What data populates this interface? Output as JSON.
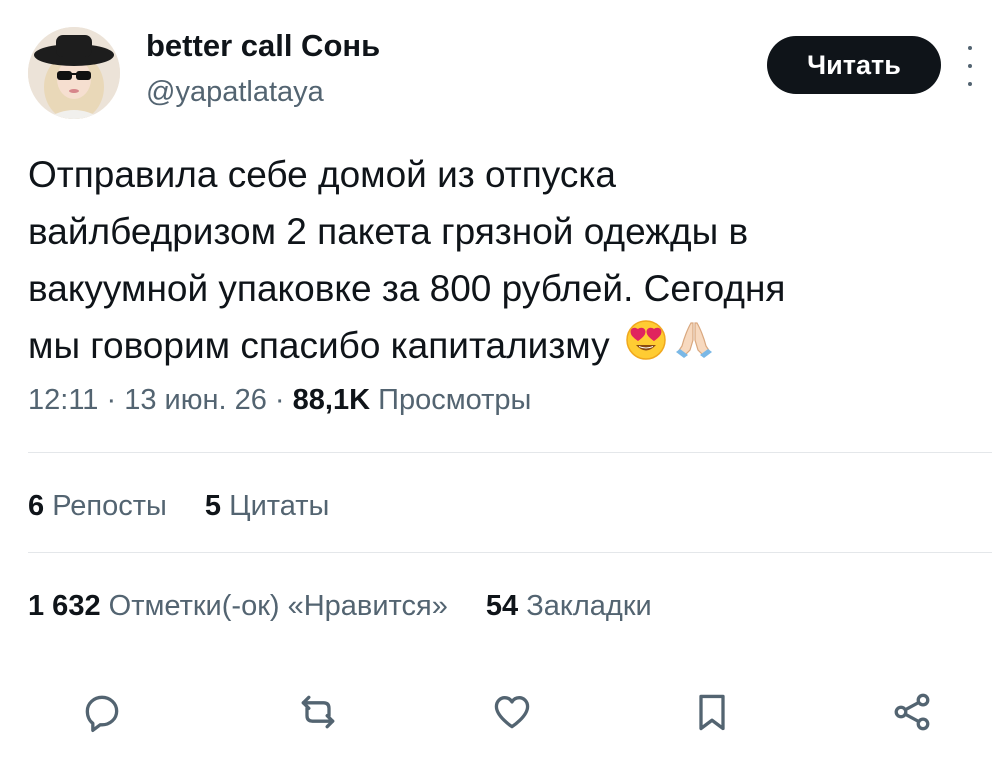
{
  "author": {
    "display_name": "better call Сонь",
    "handle": "@yapatlataya"
  },
  "header": {
    "read_label": "Читать"
  },
  "tweet": {
    "lines": [
      "Отправила себе домой из отпуска",
      "вайлбедризом 2 пакета грязной одежды в",
      "вакуумной упаковке за 800 рублей. Сегодня",
      "мы говорим спасибо капитализму"
    ],
    "emojis": [
      "heart-eyes-emoji",
      "folded-hands-emoji"
    ]
  },
  "meta": {
    "time": "12:11",
    "separator": " · ",
    "date": "13 июн. 26",
    "views_count": "88,1K",
    "views_label": "Просмотры"
  },
  "stats": {
    "reposts_count": "6",
    "reposts_label": "Репосты",
    "quotes_count": "5",
    "quotes_label": "Цитаты",
    "likes_count": "1 632",
    "likes_label": "Отметки(-ок) «Нравится»",
    "bookmarks_count": "54",
    "bookmarks_label": "Закладки"
  },
  "actions": [
    "reply-icon",
    "repost-icon",
    "like-icon",
    "bookmark-icon",
    "share-icon"
  ],
  "colors": {
    "text": "#0f1419",
    "secondary": "#536471",
    "divider": "#e4e7ea",
    "button_bg": "#0f1419"
  }
}
